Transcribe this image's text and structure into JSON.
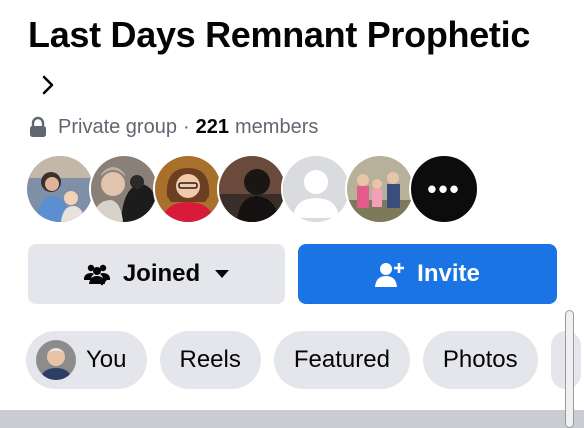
{
  "group": {
    "name": "Last Days Remnant Prophetic",
    "privacy": "Private group",
    "member_count": "221",
    "members_label": "members"
  },
  "avatars": [
    {
      "name": "member-1"
    },
    {
      "name": "member-2"
    },
    {
      "name": "member-3"
    },
    {
      "name": "member-4"
    },
    {
      "name": "member-5"
    },
    {
      "name": "member-6"
    }
  ],
  "avatars_more": "•••",
  "actions": {
    "joined_label": "Joined",
    "invite_label": "Invite"
  },
  "chips": [
    {
      "label": "You"
    },
    {
      "label": "Reels"
    },
    {
      "label": "Featured"
    },
    {
      "label": "Photos"
    }
  ],
  "colors": {
    "primary": "#1b74e4",
    "secondary_button": "#e4e6eb",
    "meta_text": "#606770"
  },
  "icons": {
    "lock": "lock-icon",
    "chevron": "chevron-right-icon",
    "joined": "group-check-icon",
    "caret": "caret-down-icon",
    "invite": "person-add-icon"
  }
}
